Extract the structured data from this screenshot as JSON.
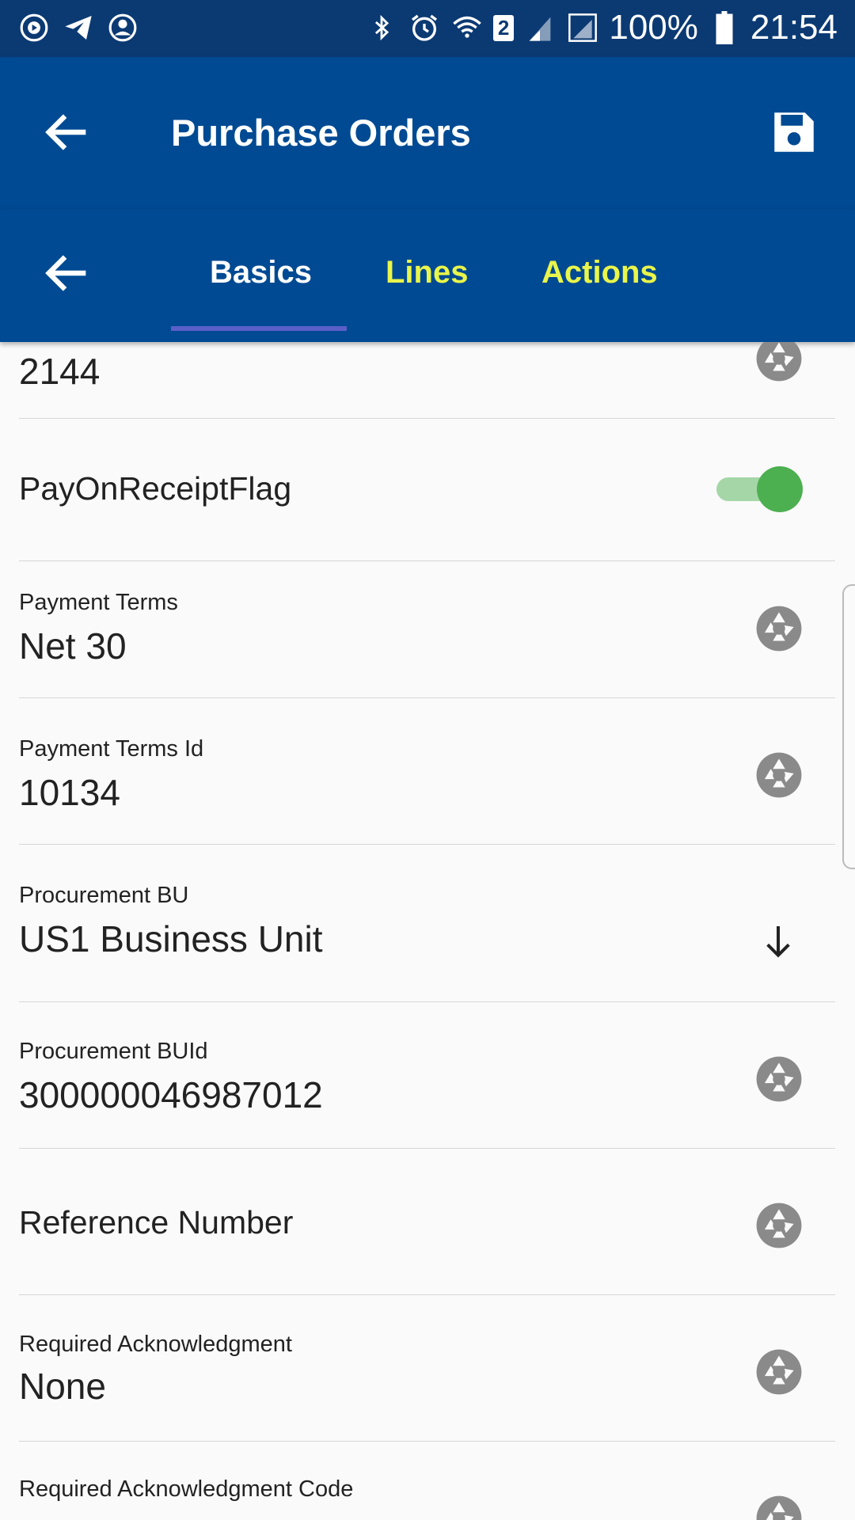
{
  "status_bar": {
    "battery": "100%",
    "time": "21:54",
    "wifi_badge": "2",
    "icons": [
      "play-circle-icon",
      "telegram-icon",
      "account-circle-icon",
      "bluetooth-icon",
      "alarm-icon",
      "wifi-icon",
      "signal-icon",
      "signal-roaming-icon",
      "battery-icon"
    ]
  },
  "app_bar": {
    "title": "Purchase Orders",
    "back_icon": "arrow-left-icon",
    "save_icon": "save-icon"
  },
  "tabs": [
    {
      "label": "Basics",
      "active": true
    },
    {
      "label": "Lines",
      "active": false
    },
    {
      "label": "Actions",
      "active": false
    }
  ],
  "colors": {
    "status_bar": "#0b3a73",
    "app_bar": "#004a93",
    "tab_active": "#ffffff",
    "tab_inactive": "#e9f54a",
    "tab_indicator": "#5b5fc7",
    "toggle_on": "#4caf50"
  },
  "fields": [
    {
      "label": "",
      "value": "2144",
      "type": "text"
    },
    {
      "label": "PayOnReceiptFlag",
      "value": true,
      "type": "toggle"
    },
    {
      "label": "Payment Terms",
      "value": "Net 30",
      "type": "text"
    },
    {
      "label": "Payment Terms Id",
      "value": "10134",
      "type": "text"
    },
    {
      "label": "Procurement BU",
      "value": "US1 Business Unit",
      "type": "dropdown"
    },
    {
      "label": "Procurement BUId",
      "value": "300000046987012",
      "type": "text"
    },
    {
      "label": "Reference Number",
      "value": "",
      "type": "text"
    },
    {
      "label": "Required Acknowledgment",
      "value": "None",
      "type": "text"
    },
    {
      "label": "Required Acknowledgment Code",
      "value": "",
      "type": "text"
    }
  ]
}
